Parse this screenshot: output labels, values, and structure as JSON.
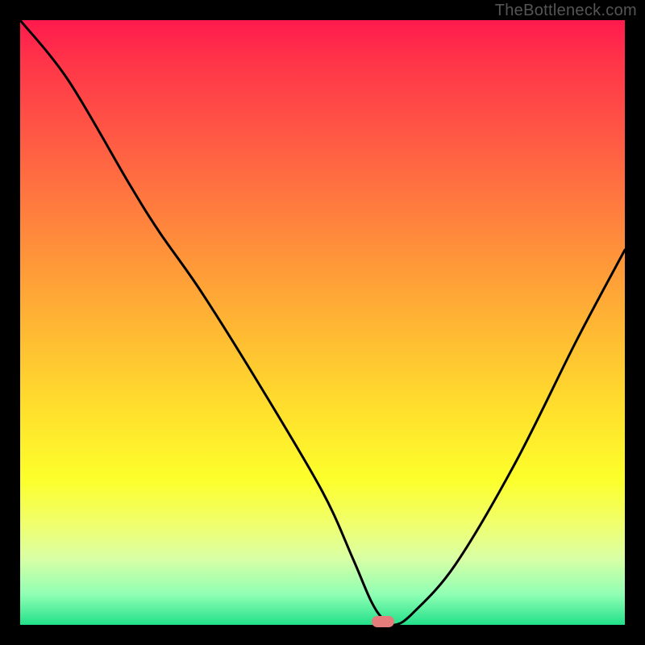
{
  "watermark": "TheBottleneck.com",
  "chart_data": {
    "type": "line",
    "title": "",
    "xlabel": "",
    "ylabel": "",
    "xlim": [
      0,
      100
    ],
    "ylim": [
      0,
      100
    ],
    "grid": false,
    "legend": false,
    "background_gradient": {
      "top_color": "#ff1a4d",
      "mid_color": "#ffe12c",
      "bottom_color": "#22e08a"
    },
    "series": [
      {
        "name": "bottleneck-curve",
        "color": "#000000",
        "x": [
          0,
          8,
          18,
          23,
          30,
          40,
          50,
          55,
          58,
          60,
          62,
          65,
          72,
          82,
          92,
          100
        ],
        "values": [
          100,
          90,
          73,
          65,
          55,
          39,
          22,
          11,
          4,
          1,
          0,
          2,
          10,
          27,
          47,
          62
        ]
      }
    ],
    "annotations": [
      {
        "name": "valley-marker",
        "x": 60,
        "y": 0,
        "shape": "pill",
        "color": "#e47c7c"
      }
    ]
  }
}
